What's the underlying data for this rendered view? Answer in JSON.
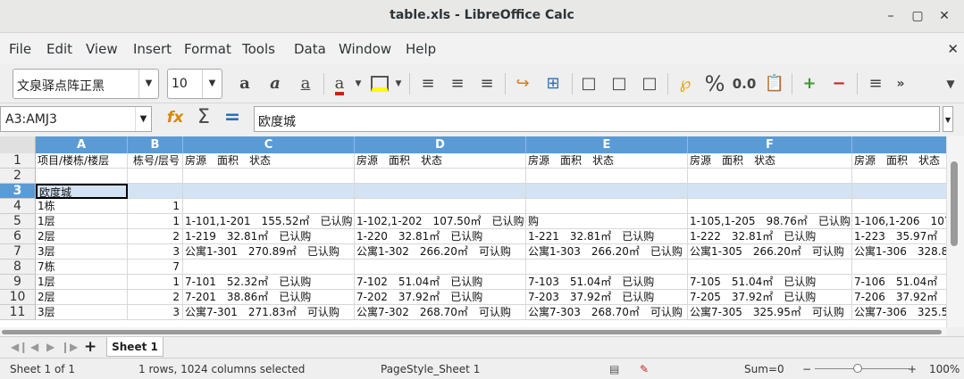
{
  "window": {
    "title": "table.xls - LibreOffice Calc"
  },
  "menu": [
    "File",
    "Edit",
    "View",
    "Insert",
    "Format",
    "Tools",
    "Data",
    "Window",
    "Help"
  ],
  "toolbar": {
    "font_name": "文泉驿点阵正黑",
    "font_size": "10",
    "percent_label": "%",
    "decimal_label": "0.0"
  },
  "formula": {
    "namebox": "A3:AMJ3",
    "content": "欧度城"
  },
  "columns": [
    "A",
    "B",
    "C",
    "D",
    "E",
    "F",
    ""
  ],
  "rows": [
    {
      "n": "1",
      "cells": [
        "项目/楼栋/楼层",
        "栋号/层号",
        "房源　面积　状态",
        "房源　面积　状态",
        "房源　面积　状态",
        "房源　面积　状态",
        "房源　面积　状态"
      ]
    },
    {
      "n": "2",
      "cells": [
        "",
        "",
        "",
        "",
        "",
        "",
        ""
      ]
    },
    {
      "n": "3",
      "cells": [
        "欧度城",
        "",
        "",
        "",
        "",
        "",
        ""
      ]
    },
    {
      "n": "4",
      "cells": [
        "1栋",
        "1",
        "",
        "",
        "",
        "",
        ""
      ]
    },
    {
      "n": "5",
      "cells": [
        "1层",
        "1",
        "1-101,1-201　155.52㎡　已认购",
        "1-102,1-202　107.50㎡　已认购",
        "购",
        "1-105,1-205　98.76㎡　已认购",
        "1-106,1-206　107"
      ]
    },
    {
      "n": "6",
      "cells": [
        "2层",
        "2",
        "1-219　32.81㎡　已认购",
        "1-220　32.81㎡　已认购",
        "1-221　32.81㎡　已认购",
        "1-222　32.81㎡　已认购",
        "1-223　35.97㎡"
      ]
    },
    {
      "n": "7",
      "cells": [
        "3层",
        "3",
        "公寓1-301　270.89㎡　已认购",
        "公寓1-302　266.20㎡　可认购",
        "公寓1-303　266.20㎡　已认购",
        "公寓1-305　266.20㎡　可认购",
        "公寓1-306　328.8"
      ]
    },
    {
      "n": "8",
      "cells": [
        "7栋",
        "7",
        "",
        "",
        "",
        "",
        ""
      ]
    },
    {
      "n": "9",
      "cells": [
        "1层",
        "1",
        "7-101　52.32㎡　已认购",
        "7-102　51.04㎡　已认购",
        "7-103　51.04㎡　已认购",
        "7-105　51.04㎡　已认购",
        "7-106　51.04㎡"
      ]
    },
    {
      "n": "10",
      "cells": [
        "2层",
        "2",
        "7-201　38.86㎡　已认购",
        "7-202　37.92㎡　已认购",
        "7-203　37.92㎡　已认购",
        "7-205　37.92㎡　已认购",
        "7-206　37.92㎡"
      ]
    },
    {
      "n": "11",
      "cells": [
        "3层",
        "3",
        "公寓7-301　271.83㎡　可认购",
        "公寓7-302　268.70㎡　可认购",
        "公寓7-303　268.70㎡　可认购",
        "公寓7-305　325.95㎡　可认购",
        "公寓7-306　325.5"
      ]
    }
  ],
  "sheet_tab": "Sheet 1",
  "status": {
    "sheet": "Sheet 1 of 1",
    "selection": "1 rows, 1024 columns selected",
    "page_style": "PageStyle_Sheet 1",
    "sum": "Sum=0",
    "zoom": "100%"
  }
}
